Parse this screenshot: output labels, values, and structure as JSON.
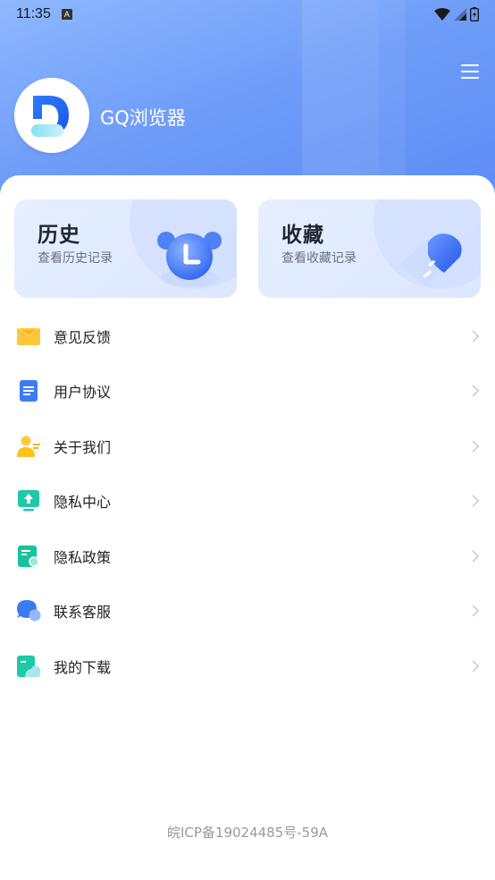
{
  "status_bar": {
    "time": "11:35",
    "notification_badge": "A"
  },
  "header": {
    "app_name": "GQ浏览器"
  },
  "cards": [
    {
      "title": "历史",
      "subtitle": "查看历史记录",
      "icon": "alarm-clock-icon"
    },
    {
      "title": "收藏",
      "subtitle": "查看收藏记录",
      "icon": "heart-icon"
    }
  ],
  "menu": [
    {
      "label": "意见反馈",
      "icon": "envelope-icon"
    },
    {
      "label": "用户协议",
      "icon": "document-icon"
    },
    {
      "label": "关于我们",
      "icon": "user-icon"
    },
    {
      "label": "隐私中心",
      "icon": "upload-monitor-icon"
    },
    {
      "label": "隐私政策",
      "icon": "policy-doc-icon"
    },
    {
      "label": "联系客服",
      "icon": "chat-bubble-icon"
    },
    {
      "label": "我的下载",
      "icon": "download-folder-icon"
    }
  ],
  "footer": {
    "icp": "皖ICP备19024485号-59A"
  },
  "colors": {
    "header_start": "#8fb8ff",
    "header_end": "#5a8af5",
    "card_bg": "#e2ebff",
    "accent": "#3b6ef5"
  }
}
